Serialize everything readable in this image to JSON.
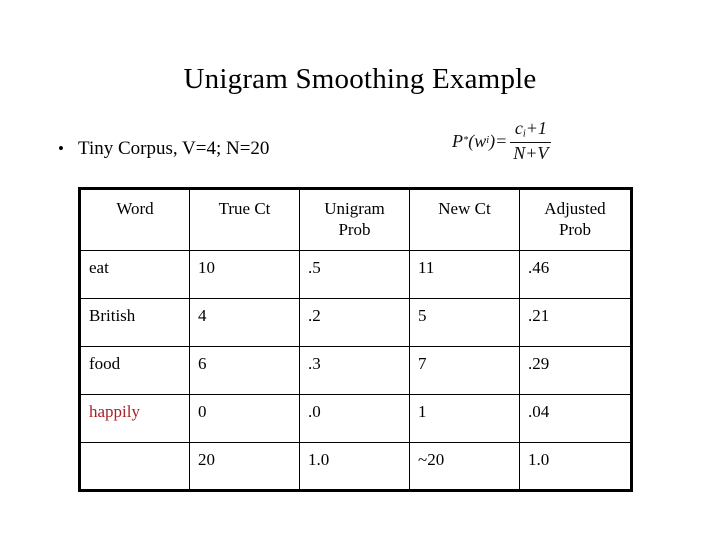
{
  "slide": {
    "title": "Unigram Smoothing Example",
    "bullet": {
      "marker": "•",
      "text": "Tiny Corpus, V=4; N=20"
    },
    "formula": {
      "lhs_p": "P",
      "lhs_p_sub": "*",
      "lhs_w": "(w",
      "lhs_w_sub": "i",
      "lhs_close": ")=",
      "numerator": "c",
      "numerator_sub": "i",
      "numerator_rest": "+1",
      "denominator": "N+V",
      "plain": "P*(wi)=(ci+1)/(N+V)"
    }
  },
  "table": {
    "headers": [
      "Word",
      "True Ct",
      "Unigram Prob",
      "New Ct",
      "Adjusted Prob"
    ],
    "header_lines": [
      [
        "Word"
      ],
      [
        "True Ct"
      ],
      [
        "Unigram",
        "Prob"
      ],
      [
        "New Ct"
      ],
      [
        "Adjusted",
        "Prob"
      ]
    ],
    "rows": [
      {
        "word": "eat",
        "word_color": "#000000",
        "true_ct": "10",
        "unigram_prob": ".5",
        "new_ct": "11",
        "adjusted_prob": ".46"
      },
      {
        "word": "British",
        "word_color": "#000000",
        "true_ct": "4",
        "unigram_prob": ".2",
        "new_ct": "5",
        "adjusted_prob": ".21"
      },
      {
        "word": "food",
        "word_color": "#000000",
        "true_ct": "6",
        "unigram_prob": ".3",
        "new_ct": "7",
        "adjusted_prob": ".29"
      },
      {
        "word": "happily",
        "word_color": "#a82226",
        "true_ct": "0",
        "unigram_prob": ".0",
        "new_ct": "1",
        "adjusted_prob": ".04"
      },
      {
        "word": "",
        "word_color": "#000000",
        "true_ct": "20",
        "unigram_prob": "1.0",
        "new_ct": "~20",
        "adjusted_prob": "1.0"
      }
    ]
  },
  "colors": {
    "background": "#ffffff",
    "text": "#000000",
    "highlight_word": "#a82226",
    "border": "#000000"
  }
}
